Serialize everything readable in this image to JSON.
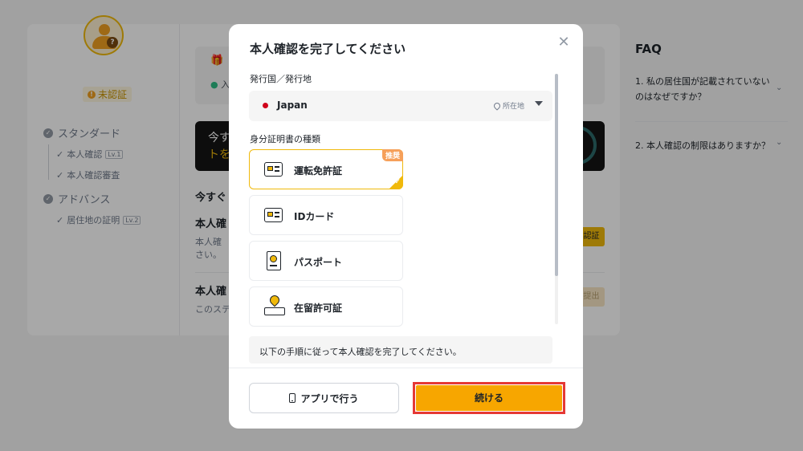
{
  "background": {
    "sidebar": {
      "status_badge": "未認証",
      "sections": [
        {
          "label": "スタンダード",
          "items": [
            {
              "label": "本人確認",
              "level": "Lv.1"
            },
            {
              "label": "本人確認審査",
              "level": ""
            }
          ]
        },
        {
          "label": "アドバンス",
          "items": [
            {
              "label": "居住地の証明",
              "level": "Lv.2"
            }
          ]
        }
      ]
    },
    "main": {
      "gift_text": "入",
      "banner_line1": "今す",
      "banner_line2": "トを",
      "heading1": "今すぐ",
      "card1_title": "本人確",
      "card1_desc1": "本人確",
      "card1_desc2": "さい。",
      "card1_button": "認証",
      "card2_title": "本人確",
      "card2_desc": "このステ",
      "card2_button": "提出"
    },
    "faq": {
      "title": "FAQ",
      "questions": [
        "1. 私の居住国が記載されていないのはなぜですか？",
        "2. 本人確認の制限はありますか？"
      ]
    }
  },
  "modal": {
    "title": "本人確認を完了してください",
    "close_icon": "close-icon",
    "country_section_label": "発行国／発行地",
    "country": {
      "name": "Japan",
      "flag_color": "#d0021b",
      "location_label": "所在地"
    },
    "doc_section_label": "身分証明書の種類",
    "documents": [
      {
        "label": "運転免許証",
        "selected": true,
        "badge": "推奨",
        "icon": "id-card-icon"
      },
      {
        "label": "IDカード",
        "selected": false,
        "icon": "id-card-icon"
      },
      {
        "label": "パスポート",
        "selected": false,
        "icon": "passport-icon"
      },
      {
        "label": "在留許可証",
        "selected": false,
        "icon": "residence-permit-icon"
      }
    ],
    "note": "以下の手順に従って本人確認を完了してください。",
    "buttons": {
      "app": "アプリで行う",
      "continue": "続ける"
    },
    "colors": {
      "accent": "#f7a600",
      "highlight_frame": "#e53935",
      "selected_border": "#f0b90b"
    }
  }
}
